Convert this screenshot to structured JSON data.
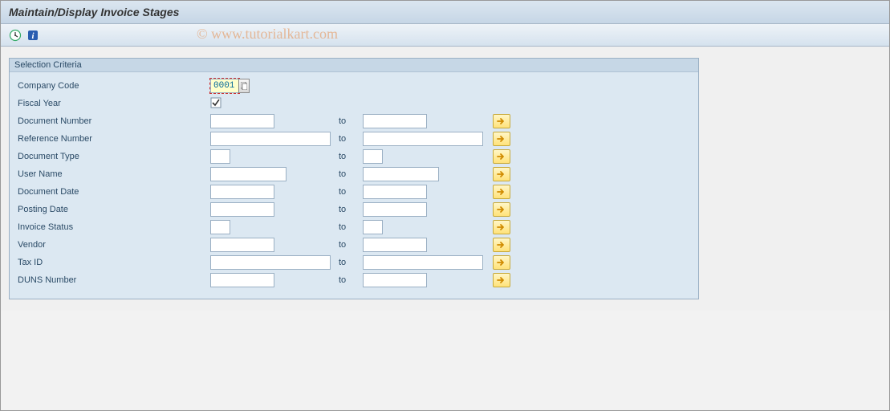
{
  "page_title": "Maintain/Display Invoice Stages",
  "watermark": "© www.tutorialkart.com",
  "toolbar": {
    "execute_icon": "execute-icon",
    "info_icon": "info-icon"
  },
  "group": {
    "title": "Selection Criteria",
    "company_code": {
      "label": "Company Code",
      "value": "0001"
    },
    "fiscal_year": {
      "label": "Fiscal Year",
      "checked": true
    },
    "to_label": "to",
    "rows": {
      "doc_number": {
        "label": "Document Number",
        "from": "",
        "to": "",
        "from_w": 80,
        "to_w": 80
      },
      "ref_number": {
        "label": "Reference Number",
        "from": "",
        "to": "",
        "from_w": 150,
        "to_w": 150
      },
      "doc_type": {
        "label": "Document Type",
        "from": "",
        "to": "",
        "from_w": 25,
        "to_w": 25
      },
      "user_name": {
        "label": "User Name",
        "from": "",
        "to": "",
        "from_w": 95,
        "to_w": 95
      },
      "doc_date": {
        "label": "Document Date",
        "from": "",
        "to": "",
        "from_w": 80,
        "to_w": 80
      },
      "post_date": {
        "label": "Posting Date",
        "from": "",
        "to": "",
        "from_w": 80,
        "to_w": 80
      },
      "inv_status": {
        "label": "Invoice Status",
        "from": "",
        "to": "",
        "from_w": 25,
        "to_w": 25
      },
      "vendor": {
        "label": "Vendor",
        "from": "",
        "to": "",
        "from_w": 80,
        "to_w": 80
      },
      "tax_id": {
        "label": "Tax ID",
        "from": "",
        "to": "",
        "from_w": 150,
        "to_w": 150
      },
      "duns": {
        "label": "DUNS Number",
        "from": "",
        "to": "",
        "from_w": 80,
        "to_w": 80
      }
    }
  }
}
